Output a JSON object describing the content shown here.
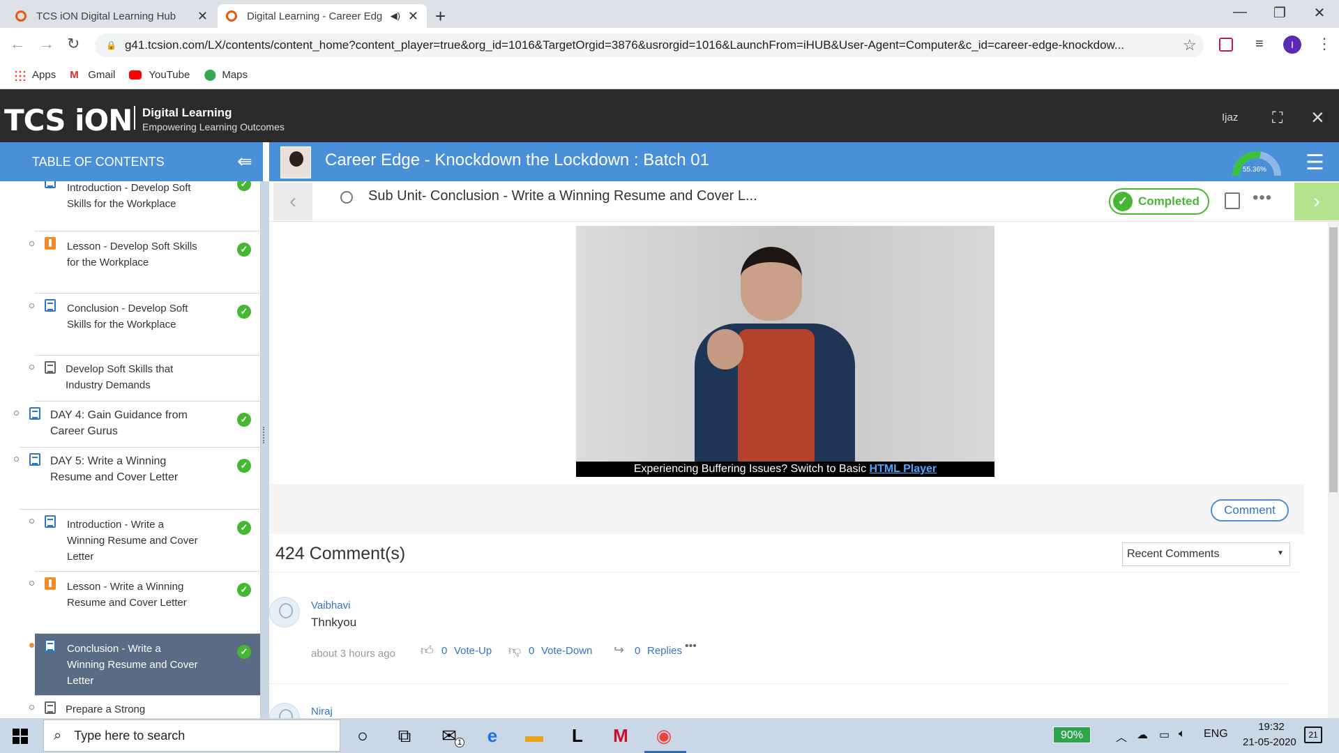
{
  "browser": {
    "tabs": [
      {
        "title": "TCS iON Digital Learning Hub",
        "active": false
      },
      {
        "title": "Digital Learning - Career Edg",
        "active": true
      }
    ],
    "url": "g41.tcsion.com/LX/contents/content_home?content_player=true&org_id=1016&TargetOrgid=3876&usrorgid=1016&LaunchFrom=iHUB&User-Agent=Computer&c_id=career-edge-knockdow...",
    "bookmarks": [
      "Apps",
      "Gmail",
      "YouTube",
      "Maps"
    ],
    "profile_initial": "I"
  },
  "app": {
    "logo": "TCS iON",
    "title": "Digital Learning",
    "subtitle": "Empowering Learning Outcomes",
    "user": "Ijaz"
  },
  "toc": {
    "header": "TABLE OF CONTENTS",
    "items": [
      {
        "label": "Introduction - Develop Soft Skills for the Workplace",
        "icon": "doc",
        "done": true
      },
      {
        "label": "Lesson - Develop Soft Skills for the Workplace",
        "icon": "lesson",
        "done": true
      },
      {
        "label": "Conclusion - Develop Soft Skills for the Workplace",
        "icon": "doc",
        "done": true
      },
      {
        "label": "Develop Soft Skills that Industry Demands",
        "icon": "list",
        "done": false
      },
      {
        "label": "DAY 4: Gain Guidance from Career Gurus",
        "icon": "doc",
        "done": true
      },
      {
        "label": "DAY 5: Write a Winning Resume and Cover Letter",
        "icon": "doc",
        "done": true
      },
      {
        "label": "Introduction - Write a Winning Resume and Cover Letter",
        "icon": "doc",
        "done": true
      },
      {
        "label": "Lesson - Write a Winning Resume and Cover Letter",
        "icon": "lesson",
        "done": true
      },
      {
        "label": "Conclusion - Write a Winning Resume and Cover Letter",
        "icon": "doc",
        "done": true,
        "selected": true
      },
      {
        "label": "Prepare a Strong",
        "icon": "list",
        "done": false
      }
    ]
  },
  "course": {
    "title": "Career Edge - Knockdown the Lockdown : Batch 01",
    "progress_label": "55.36%",
    "progress": 55.36
  },
  "subunit": {
    "title": "Sub Unit- Conclusion - Write a Winning Resume and Cover L...",
    "status": "Completed"
  },
  "video": {
    "caption_text": "Experiencing Buffering Issues? Switch to Basic ",
    "caption_link": "HTML Player"
  },
  "comments": {
    "button": "Comment",
    "count_label": "424 Comment(s)",
    "sort_selected": "Recent Comments",
    "list": [
      {
        "name": "Vaibhavi",
        "text": "Thnkyou",
        "time": "about 3 hours ago",
        "upvotes": "0",
        "upvote_label": "Vote-Up",
        "downvotes": "0",
        "downvote_label": "Vote-Down",
        "replies": "0",
        "replies_label": "Replies"
      },
      {
        "name": "Niraj"
      }
    ]
  },
  "taskbar": {
    "search_placeholder": "Type here to search",
    "battery": "90%",
    "language": "ENG",
    "time": "19:32",
    "date": "21-05-2020",
    "notifications": "21",
    "mail_badge": "1"
  }
}
